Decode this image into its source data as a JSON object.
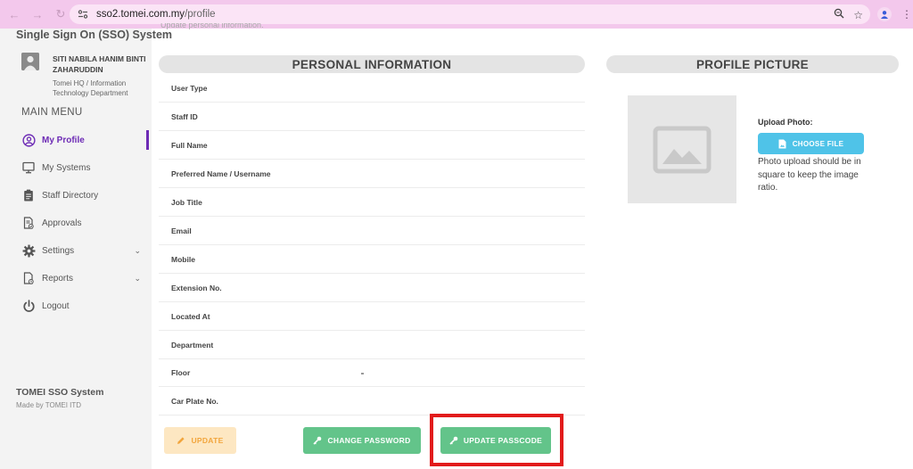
{
  "browser": {
    "url_host": "sso2.tomei.com.my",
    "url_path": "/profile"
  },
  "sidebar": {
    "system_title": "Single Sign On (SSO) System",
    "user_name": "SITI NABILA HANIM BINTI ZAHARUDDIN",
    "user_dept": "Tomei HQ / Information Technology Department",
    "menu_heading": "MAIN MENU",
    "items": [
      {
        "label": "My Profile",
        "icon": "user-circle-icon",
        "active": true
      },
      {
        "label": "My Systems",
        "icon": "monitor-icon"
      },
      {
        "label": "Staff Directory",
        "icon": "clipboard-icon"
      },
      {
        "label": "Approvals",
        "icon": "document-check-icon"
      },
      {
        "label": "Settings",
        "icon": "gear-icon",
        "expandable": true
      },
      {
        "label": "Reports",
        "icon": "report-icon",
        "expandable": true
      },
      {
        "label": "Logout",
        "icon": "power-icon"
      }
    ],
    "footer_title": "TOMEI SSO System",
    "footer_sub": "Made by TOMEI ITD"
  },
  "main": {
    "cut_text": "Update personal information.",
    "personal_info_title": "PERSONAL INFORMATION",
    "fields": [
      {
        "label": "User Type"
      },
      {
        "label": "Staff ID"
      },
      {
        "label": "Full Name"
      },
      {
        "label": "Preferred Name / Username"
      },
      {
        "label": "Job Title"
      },
      {
        "label": "Email"
      },
      {
        "label": "Mobile"
      },
      {
        "label": "Extension No."
      },
      {
        "label": "Located At"
      },
      {
        "label": "Department"
      },
      {
        "label": "Floor"
      },
      {
        "label": "Car Plate No."
      }
    ],
    "buttons": {
      "update": "UPDATE",
      "change_password": "CHANGE PASSWORD",
      "update_passcode": "UPDATE PASSCODE"
    }
  },
  "profile_picture": {
    "title": "PROFILE PICTURE",
    "upload_label": "Upload Photo:",
    "choose_file": "CHOOSE FILE",
    "hint": "Photo upload should be in square to keep the image ratio."
  },
  "colors": {
    "browser_bar": "#f3c8ec",
    "accent_purple": "#6d2bb5",
    "green_button": "#63c48a",
    "update_button": "#fde7c2",
    "choose_button": "#4fc3e8",
    "highlight_red": "#e21b1b"
  }
}
